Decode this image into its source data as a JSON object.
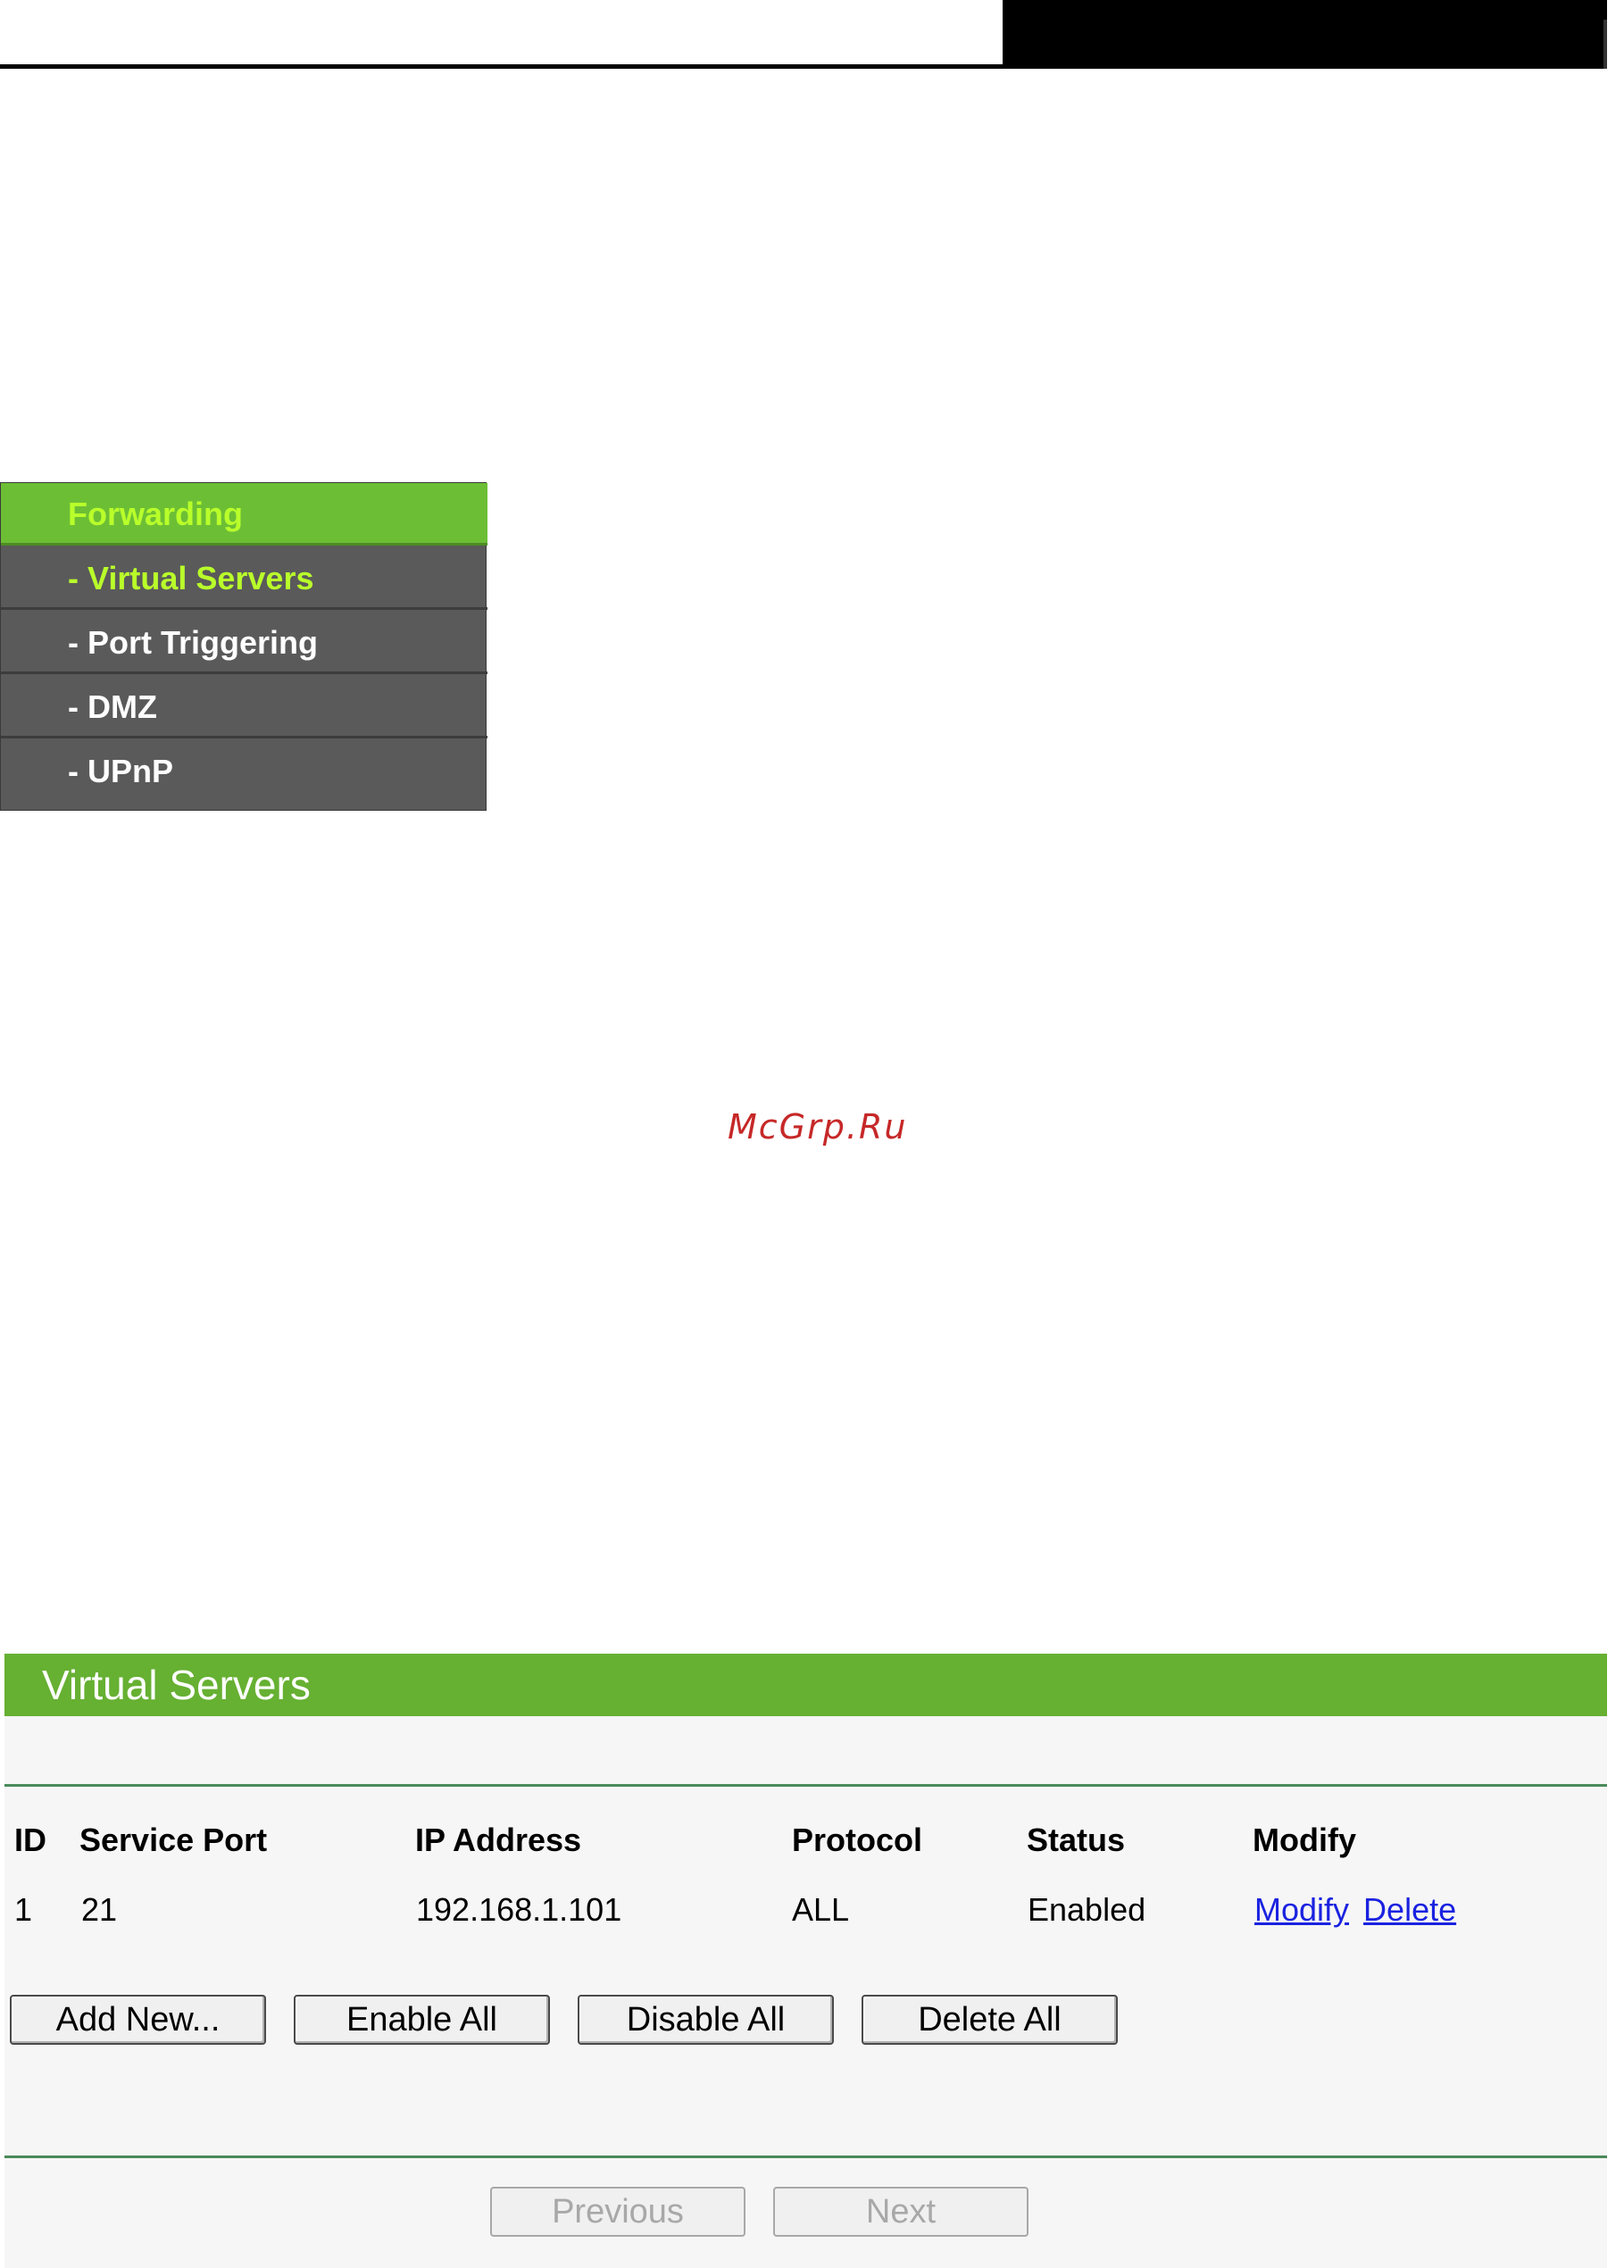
{
  "menu": {
    "items": [
      {
        "label": "Forwarding"
      },
      {
        "label": "- Virtual Servers"
      },
      {
        "label": "- Port Triggering"
      },
      {
        "label": "- DMZ"
      },
      {
        "label": "- UPnP"
      }
    ]
  },
  "watermark": "McGrp.Ru",
  "panel": {
    "title": "Virtual Servers",
    "columns": [
      "ID",
      "Service Port",
      "IP Address",
      "Protocol",
      "Status",
      "Modify"
    ],
    "rows": [
      {
        "id": "1",
        "service_port": "21",
        "ip": "192.168.1.101",
        "protocol": "ALL",
        "status": "Enabled",
        "modify": "Modify",
        "delete": "Delete"
      }
    ],
    "buttons": {
      "add_new": "Add New...",
      "enable_all": "Enable All",
      "disable_all": "Disable All",
      "delete_all": "Delete All"
    },
    "pager": {
      "previous": "Previous",
      "next": "Next"
    }
  }
}
